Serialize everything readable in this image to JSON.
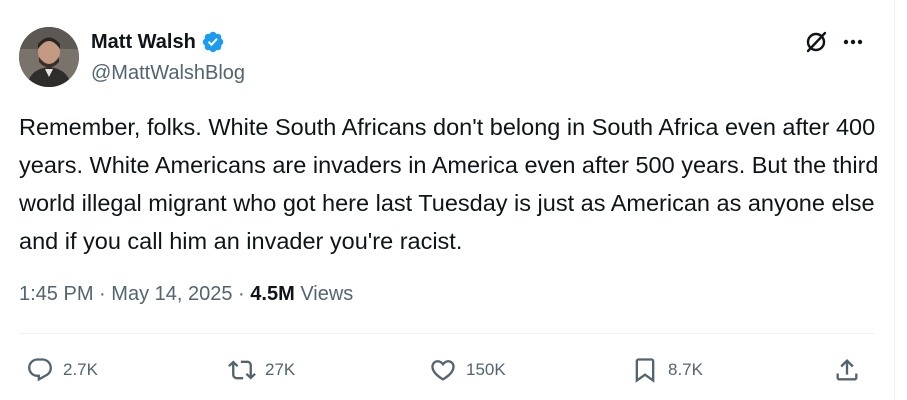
{
  "author": {
    "name": "Matt Walsh",
    "handle": "@MattWalshBlog"
  },
  "tweet": {
    "text": "Remember, folks. White South Africans don't belong in South Africa even after 400 years. White Americans are invaders in America even after 500 years. But the third world illegal migrant who got here last Tuesday is just as American as anyone else and if you call him an invader you're racist."
  },
  "meta": {
    "time": "1:45 PM",
    "separator": "·",
    "date": "May 14, 2025",
    "views_count": "4.5M",
    "views_label": "Views"
  },
  "actions": {
    "replies": "2.7K",
    "reposts": "27K",
    "likes": "150K",
    "bookmarks": "8.7K"
  },
  "icons": {
    "verified": "verified-badge-icon",
    "grok": "grok-icon",
    "more": "more-icon",
    "reply": "reply-icon",
    "repost": "repost-icon",
    "like": "like-icon",
    "bookmark": "bookmark-icon",
    "share": "share-icon"
  },
  "colors": {
    "verified_blue": "#1d9bf0",
    "text_primary": "#0f1419",
    "text_secondary": "#536471",
    "divider": "#eff3f4"
  }
}
